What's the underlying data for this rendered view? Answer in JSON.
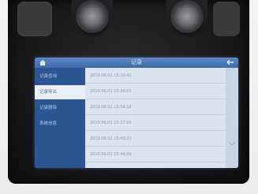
{
  "window": {
    "title": "记录"
  },
  "sidebar": {
    "items": [
      {
        "label": "记录查询",
        "active": false
      },
      {
        "label": "记录导出",
        "active": true
      },
      {
        "label": "记录删除",
        "active": false
      },
      {
        "label": "系统信息",
        "active": false
      }
    ]
  },
  "records": [
    {
      "text": "2019.06.01 15:26:42"
    },
    {
      "text": "2019.06.01 15:30:05"
    },
    {
      "text": "2019.06.01 15:34:18"
    },
    {
      "text": "2019.06.01 15:37:55"
    },
    {
      "text": "2019.06.01 15:40:21"
    },
    {
      "text": "2019.06.01 15:44:09"
    }
  ],
  "icons": {
    "home": "home-icon",
    "back": "back-icon",
    "scroll_down": "chevron-down-icon"
  },
  "colors": {
    "titlebar": "#4f79b8",
    "sidebar": "#2c5592",
    "active_item": "#e9eef7",
    "list_bg": "#dbe3ef"
  }
}
